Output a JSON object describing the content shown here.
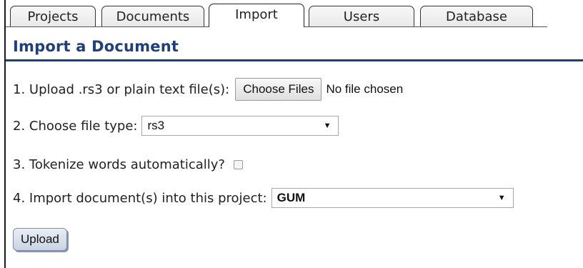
{
  "tabs": [
    {
      "label": "Projects",
      "active": false
    },
    {
      "label": "Documents",
      "active": false
    },
    {
      "label": "Import",
      "active": true
    },
    {
      "label": "Users",
      "active": false
    },
    {
      "label": "Database",
      "active": false
    }
  ],
  "page": {
    "title": "Import a Document"
  },
  "form": {
    "upload_label": "1. Upload .rs3 or plain text file(s):",
    "choose_files_label": "Choose Files",
    "file_status": "No file chosen",
    "file_type_label": "2. Choose file type:",
    "file_type_value": "rs3",
    "tokenize_label": "3. Tokenize words automatically?",
    "tokenize_checked": false,
    "project_label": "4. Import document(s) into this project:",
    "project_value": "GUM",
    "upload_button": "Upload"
  },
  "icons": {
    "dropdown": "dropdown-arrow-icon"
  },
  "colors": {
    "title": "#1f3f7a",
    "rule": "#1f3f7a"
  }
}
